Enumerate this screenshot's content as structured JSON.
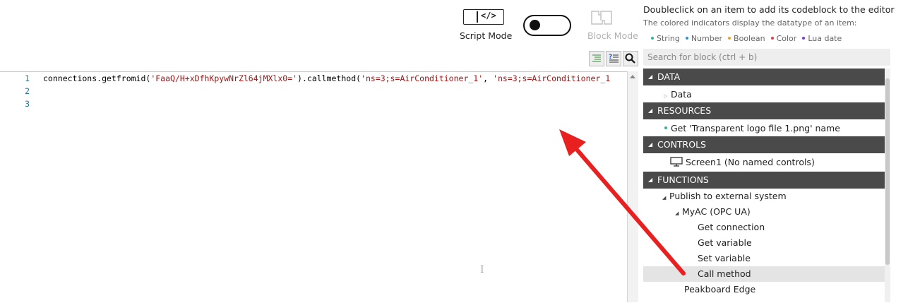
{
  "toolbar": {
    "script_mode_label": "Script Mode",
    "block_mode_label": "Block Mode",
    "script_icon_glyph": "</>",
    "toggle_state": "script"
  },
  "help": {
    "title": "Doubleclick on an item to add its codeblock to the editor",
    "subtitle": "The colored indicators display the datatype of an item:",
    "legend": [
      {
        "label": "String",
        "color": "#2bb5a0"
      },
      {
        "label": "Number",
        "color": "#2f8fd6"
      },
      {
        "label": "Boolean",
        "color": "#f0a020"
      },
      {
        "label": "Color",
        "color": "#e04040"
      },
      {
        "label": "Lua date",
        "color": "#7a3fc0"
      }
    ]
  },
  "search": {
    "placeholder": "Search for block (ctrl + b)"
  },
  "tools": [
    "align-lines-icon",
    "script-help-icon",
    "search-icon"
  ],
  "editor": {
    "line_numbers": [
      "1",
      "2",
      "3"
    ],
    "code": {
      "prefix": "connections.getfromid(",
      "id": "'FaaQ/H+xDfhKpywNrZl64jMXlx0='",
      "middle": ").callmethod(",
      "arg1": "'ns=3;s=AirConditioner_1'",
      "sep": ", ",
      "arg2": "'ns=3;s=AirConditioner_1"
    }
  },
  "panel": {
    "sections": {
      "data": "DATA",
      "resources": "RESOURCES",
      "controls": "CONTROLS",
      "functions": "FUNCTIONS"
    },
    "items": {
      "data": "Data",
      "resource": "Get 'Transparent logo file 1.png' name",
      "screen": "Screen1 (No named controls)",
      "publish": "Publish to external system",
      "myac": "MyAC (OPC UA)",
      "get_connection": "Get connection",
      "get_variable": "Get variable",
      "set_variable": "Set variable",
      "call_method": "Call method",
      "peakboard_edge": "Peakboard Edge"
    }
  },
  "colors": {
    "accent_arrow": "#e8201f",
    "section_header": "#4a4a4a",
    "string_literal": "#a31515",
    "line_number": "#237893"
  }
}
